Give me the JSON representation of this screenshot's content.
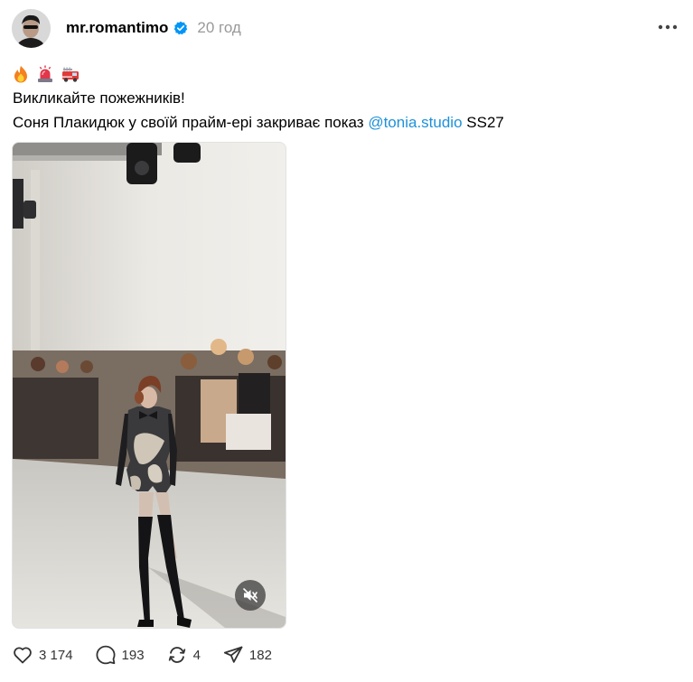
{
  "post": {
    "username": "mr.romantimo",
    "time": "20 год",
    "emoji_line": [
      "fire-emoji",
      "rotating-light-emoji",
      "fire-engine-emoji"
    ],
    "text_line1": "Викликайте пожежників!",
    "text_line2_prefix": "Соня Плакидюк у своїй прайм-ері закриває показ",
    "mention": "@tonia.studio",
    "text_line2_suffix": "SS27",
    "media": {
      "type": "video",
      "muted": true
    }
  },
  "actions": {
    "likes": "3 174",
    "replies": "193",
    "reposts": "4",
    "shares": "182"
  },
  "colors": {
    "accent": "#1d91d9",
    "verified": "#0095f6",
    "secondary_text": "#999999"
  },
  "icons": [
    "more-icon",
    "verified-icon",
    "mute-icon",
    "heart-icon",
    "comment-icon",
    "repost-icon",
    "share-icon"
  ]
}
